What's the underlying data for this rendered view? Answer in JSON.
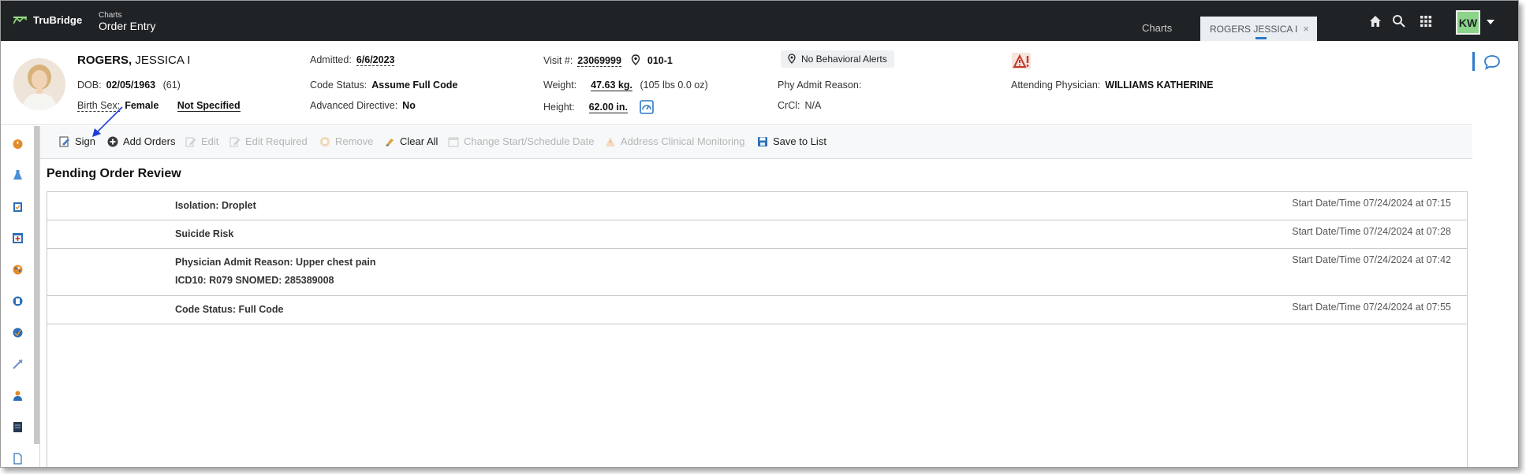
{
  "topbar": {
    "logo": "TruBridge",
    "crumb": "Charts",
    "title": "Order Entry",
    "tabs": [
      {
        "label": "Charts"
      },
      {
        "label": "ROGERS JESSICA I"
      }
    ],
    "close_glyph": "×",
    "user_initials": "KW",
    "icons": [
      "home-icon",
      "search-icon",
      "apps-grid-icon"
    ]
  },
  "patient": {
    "last_name": "ROGERS,",
    "first_name": "JESSICA I",
    "dob_label": "DOB:",
    "dob": "02/05/1963",
    "age": "(61)",
    "sex_label": "Birth Sex:",
    "sex": "Female",
    "gender": "Not Specified",
    "admitted_label": "Admitted:",
    "admitted": "6/6/2023",
    "code_status_label": "Code Status:",
    "code_status": "Assume Full Code",
    "adv_directive_label": "Advanced Directive:",
    "adv_directive": "No",
    "visit_label": "Visit #:",
    "visit": "23069999",
    "location": "010-1",
    "weight_label": "Weight:",
    "weight": "47.63 kg.",
    "weight_alt": "(105 lbs 0.0 oz)",
    "height_label": "Height:",
    "height": "62.00 in.",
    "alerts": "No Behavioral Alerts",
    "phy_admit_label": "Phy Admit Reason:",
    "crcl_label": "CrCl:",
    "crcl": "N/A",
    "attending_label": "Attending Physician:",
    "attending": "WILLIAMS KATHERINE"
  },
  "toolbar": {
    "sign": "Sign",
    "add_orders": "Add Orders",
    "edit": "Edit",
    "edit_required": "Edit Required",
    "remove": "Remove",
    "clear_all": "Clear All",
    "change_start": "Change Start/Schedule Date",
    "address_monitoring": "Address Clinical Monitoring",
    "save_to_list": "Save to List"
  },
  "section_title": "Pending Order Review",
  "orders": [
    {
      "line1": "Isolation: Droplet",
      "line2": "",
      "date": "Start Date/Time 07/24/2024 at 07:15"
    },
    {
      "line1": "Suicide Risk",
      "line2": "",
      "date": "Start Date/Time 07/24/2024 at 07:28"
    },
    {
      "line1": "Physician Admit Reason: Upper chest pain",
      "line2": "ICD10: R079 SNOMED: 285389008",
      "date": "Start Date/Time 07/24/2024 at 07:42"
    },
    {
      "line1": "Code Status: Full Code",
      "line2": "",
      "date": "Start Date/Time 07/24/2024 at 07:55"
    }
  ],
  "colors": {
    "topbar": "#1f2326",
    "accent": "#2c7ac9",
    "avatar": "#8bd48a",
    "annotation_arrow": "#1a3fd6"
  }
}
